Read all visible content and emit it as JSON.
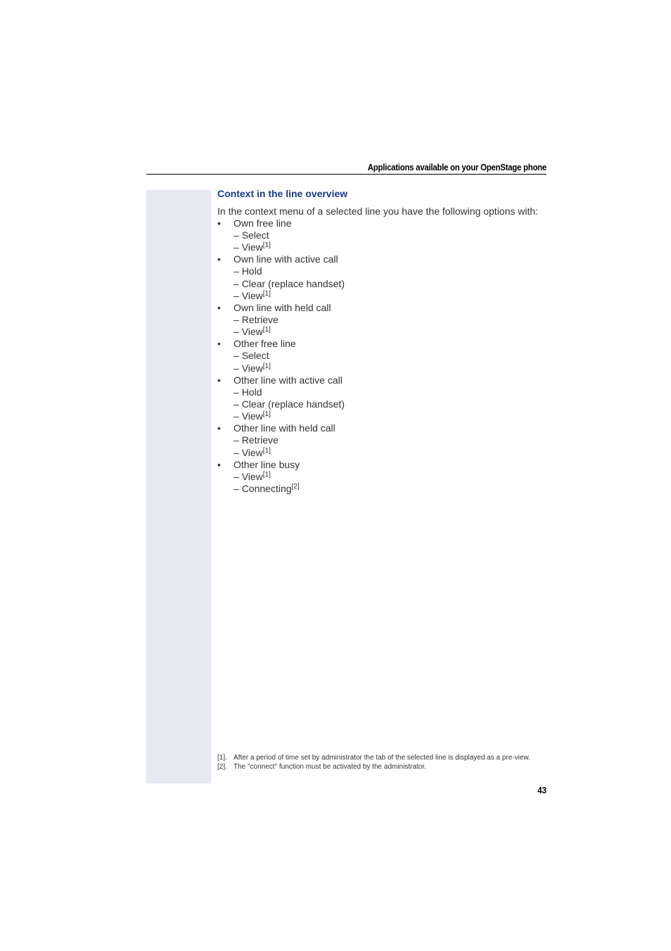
{
  "header": {
    "title": "Applications available on your OpenStage phone"
  },
  "section": {
    "title": "Context in the line overview",
    "intro": "In the context menu of a selected line you have the following options with:",
    "bullet_symbol": "•",
    "dash_symbol": "–",
    "items": [
      {
        "label": "Own free line",
        "options": [
          {
            "text": "Select",
            "note": ""
          },
          {
            "text": "View",
            "note": "[1]"
          }
        ]
      },
      {
        "label": "Own line with active call",
        "options": [
          {
            "text": "Hold",
            "note": ""
          },
          {
            "text": "Clear (replace handset)",
            "note": ""
          },
          {
            "text": "View",
            "note": "[1]"
          }
        ]
      },
      {
        "label": "Own line with held call",
        "options": [
          {
            "text": "Retrieve",
            "note": ""
          },
          {
            "text": "View",
            "note": "[1]"
          }
        ]
      },
      {
        "label": "Other free line",
        "options": [
          {
            "text": "Select",
            "note": ""
          },
          {
            "text": "View",
            "note": "[1]"
          }
        ]
      },
      {
        "label": "Other line with active call",
        "options": [
          {
            "text": "Hold",
            "note": ""
          },
          {
            "text": "Clear (replace handset)",
            "note": ""
          },
          {
            "text": "View",
            "note": "[1]"
          }
        ]
      },
      {
        "label": "Other line with held call",
        "options": [
          {
            "text": "Retrieve",
            "note": ""
          },
          {
            "text": "View",
            "note": "[1]"
          }
        ]
      },
      {
        "label": "Other line busy",
        "options": [
          {
            "text": "View",
            "note": "[1]"
          },
          {
            "text": "Connecting",
            "note": "[2]"
          }
        ]
      }
    ]
  },
  "footnotes": [
    {
      "mark": "[1].",
      "text": "After a period of time set by administrator the tab of the selected line is displayed as a pre-view."
    },
    {
      "mark": "[2].",
      "text": "The \"connect\" function must be activated by the administrator."
    }
  ],
  "page_number": "43",
  "colors": {
    "heading": "#1a3a8a",
    "sidebar": "#e6e8f2"
  }
}
